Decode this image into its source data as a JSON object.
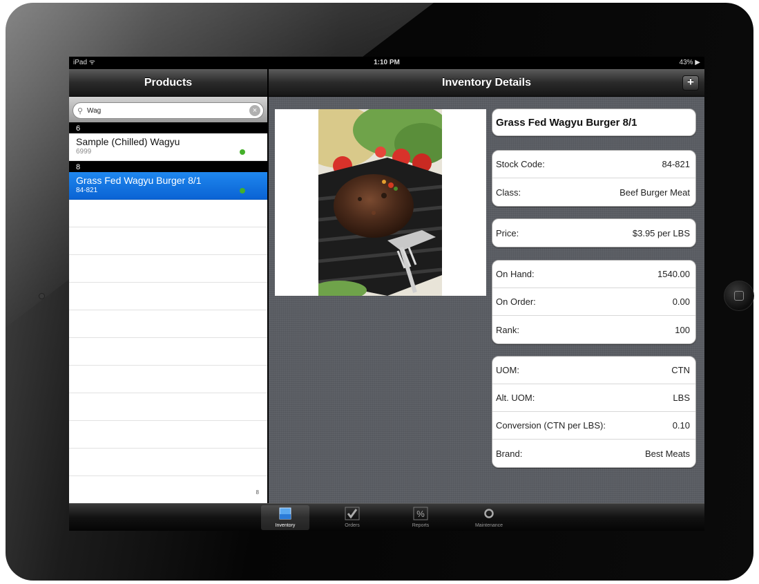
{
  "status_bar": {
    "carrier": "iPad ᯤ",
    "time": "1:10 PM",
    "battery": "43% ▶"
  },
  "products_panel": {
    "title": "Products",
    "search": {
      "value": "Wag",
      "placeholder": ""
    },
    "sections": [
      {
        "header": "6",
        "items": [
          {
            "name": "Sample (Chilled) Wagyu",
            "code": "6999",
            "selected": false
          }
        ]
      },
      {
        "header": "8",
        "items": [
          {
            "name": "Grass Fed Wagyu Burger 8/1",
            "code": "84-821",
            "selected": true
          }
        ]
      }
    ],
    "index_hint": "8"
  },
  "details_panel": {
    "title": "Inventory Details",
    "add_label": "+",
    "product_title": "Grass Fed Wagyu Burger 8/1",
    "groups": [
      [
        {
          "label": "Stock Code:",
          "value": "84-821"
        },
        {
          "label": "Class:",
          "value": "Beef Burger Meat"
        }
      ],
      [
        {
          "label": "Price:",
          "value": "$3.95 per LBS"
        }
      ],
      [
        {
          "label": "On Hand:",
          "value": "1540.00"
        },
        {
          "label": "On Order:",
          "value": "0.00"
        },
        {
          "label": "Rank:",
          "value": "100"
        }
      ],
      [
        {
          "label": "UOM:",
          "value": "CTN"
        },
        {
          "label": "Alt. UOM:",
          "value": "LBS"
        },
        {
          "label": "Conversion (CTN per LBS):",
          "value": "0.10"
        },
        {
          "label": "Brand:",
          "value": "Best Meats"
        }
      ]
    ]
  },
  "tab_bar": {
    "tabs": [
      {
        "label": "Inventory",
        "icon": "inventory-icon",
        "active": true
      },
      {
        "label": "Orders",
        "icon": "checkmark-icon",
        "active": false
      },
      {
        "label": "Reports",
        "icon": "percent-icon",
        "active": false
      },
      {
        "label": "Maintenance",
        "icon": "circle-icon",
        "active": false
      }
    ]
  },
  "colors": {
    "selection_blue": "#1f87ee",
    "status_dot_green": "#44b02a",
    "detail_background": "#5a5d63"
  }
}
